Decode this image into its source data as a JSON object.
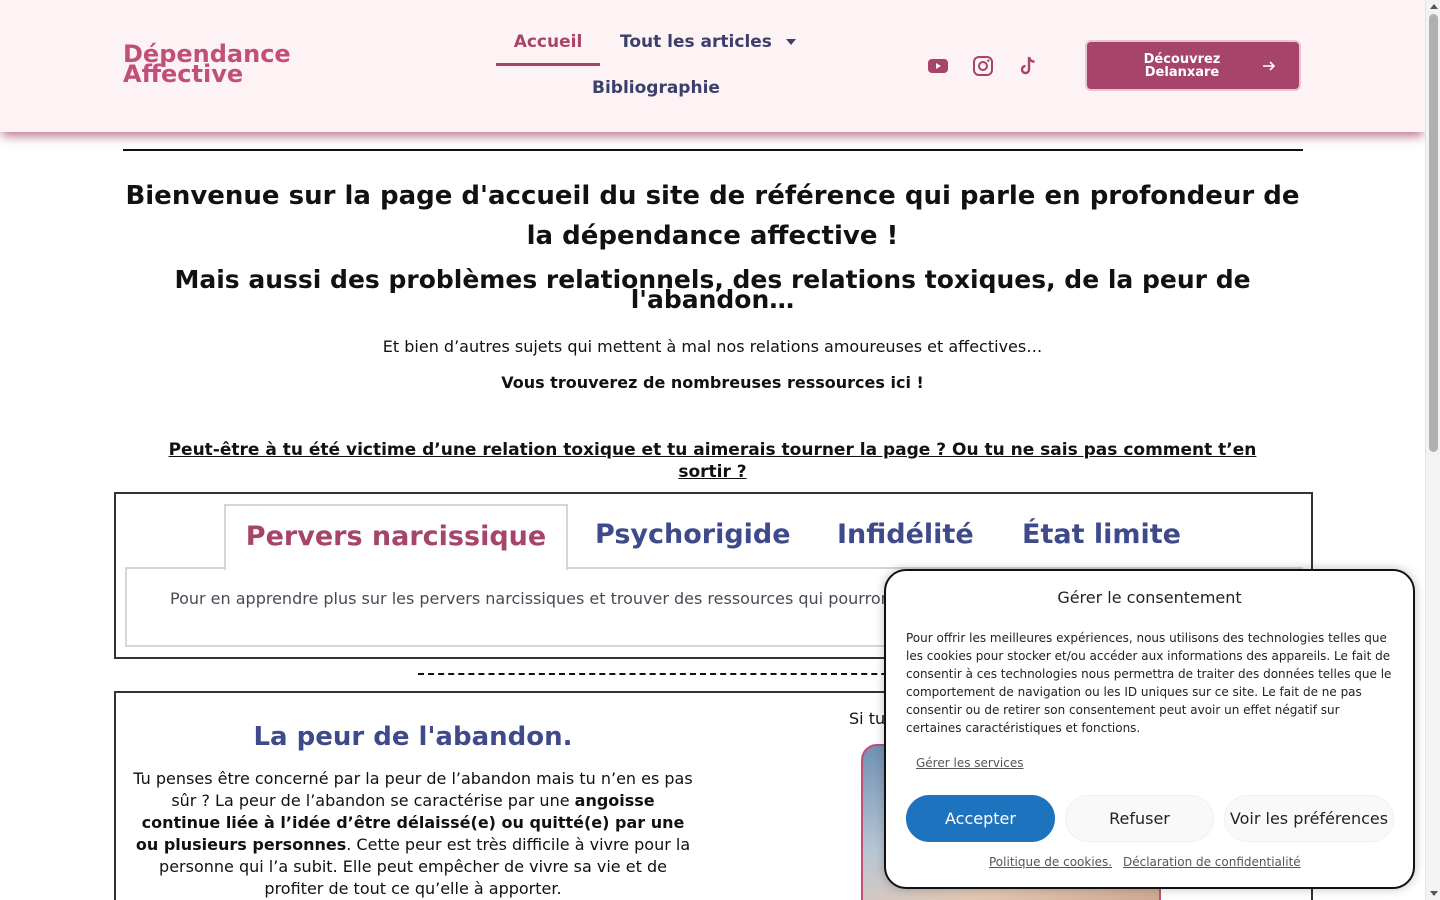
{
  "header": {
    "logo_line1": "Dépendance",
    "logo_line2": "Affective",
    "nav": {
      "home": "Accueil",
      "articles": "Tout les articles",
      "bibliography": "Bibliographie"
    },
    "social_icons": [
      "youtube-icon",
      "instagram-icon",
      "tiktok-icon"
    ],
    "cta_label": "Découvrez Delanxare"
  },
  "main": {
    "headline": "Bienvenue sur la page d'accueil du site de référence qui parle en profondeur de la dépendance affective !",
    "subheadline": "Mais aussi des problèmes relationnels, des relations toxiques, de la peur de l'abandon…",
    "lead": "Et bien d’autres sujets qui mettent à mal nos relations amoureuses et affectives…",
    "lead_bold": "Vous trouverez de nombreuses ressources ici !",
    "question": "Peut-être à tu été victime d’une relation toxique et tu aimerais tourner la page ? Ou tu ne sais pas comment t’en sortir ?",
    "tabs": [
      {
        "label": "Pervers narcissique",
        "active": true
      },
      {
        "label": "Psychorigide",
        "active": false
      },
      {
        "label": "Infidélité",
        "active": false
      },
      {
        "label": "État limite",
        "active": false
      }
    ],
    "tab_panel_text": "Pour en apprendre plus sur les pervers narcissiques et trouver des ressources qui pourron",
    "section": {
      "title": "La peur de l'abandon.",
      "text_a": "Tu penses être concerné par la peur de l’abandon mais tu n’en es pas sûr ? La peur de l’abandon se caractérise par une ",
      "text_bold": "angoisse continue liée à l’idée d’être délaissé(e) ou quitté(e) par une ou plusieurs personnes",
      "text_b": ". Cette peur est très difficile à vivre pour la personne qui l’a subit. Elle peut empêcher de vivre sa vie et de profiter de tout ce qu’elle à apporter.",
      "side_text": "Si tu"
    }
  },
  "consent": {
    "title": "Gérer le consentement",
    "body": "Pour offrir les meilleures expériences, nous utilisons des technologies telles que les cookies pour stocker et/ou accéder aux informations des appareils. Le fait de consentir à ces technologies nous permettra de traiter des données telles que le comportement de navigation ou les ID uniques sur ce site. Le fait de ne pas consentir ou de retirer son consentement peut avoir un effet négatif sur certaines caractéristiques et fonctions.",
    "manage_services": "Gérer les services",
    "accept": "Accepter",
    "refuse": "Refuser",
    "preferences": "Voir les préférences",
    "cookie_policy": "Politique de cookies.",
    "privacy": "Déclaration de confidentialité"
  },
  "colors": {
    "brand": "#a6446a",
    "logo": "#c0507a",
    "tab_blue": "#3e4a8a",
    "accept_blue": "#1e73be"
  }
}
